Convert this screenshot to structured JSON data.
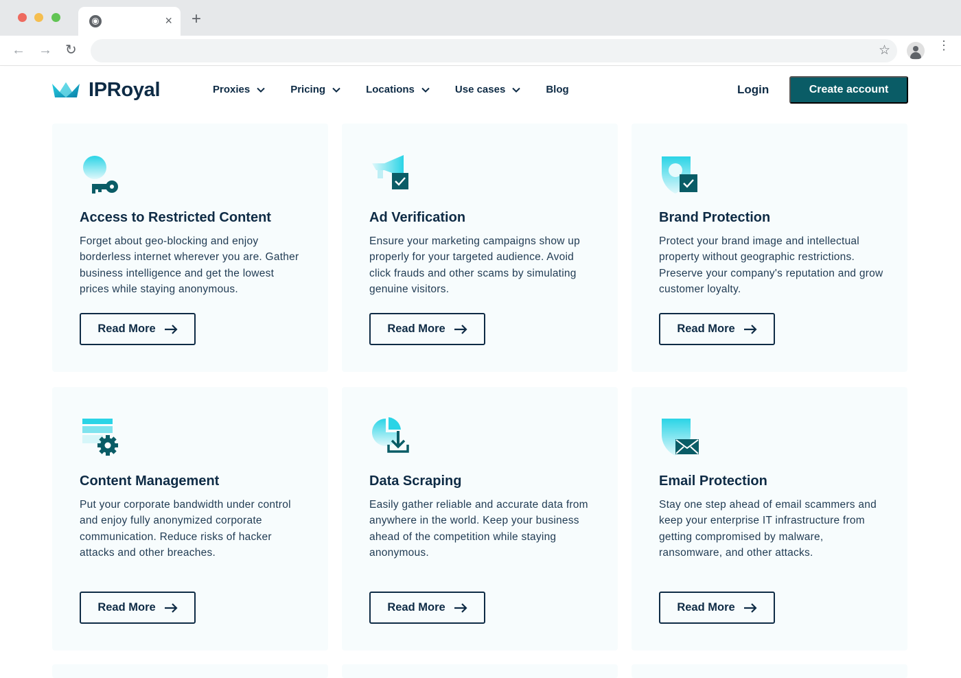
{
  "browser": {
    "tab_close": "×",
    "new_tab": "+",
    "back": "←",
    "forward": "→",
    "reload": "↻",
    "star": "☆",
    "menu": "⋮"
  },
  "header": {
    "logo_text": "IPRoyal",
    "nav": [
      {
        "label": "Proxies",
        "has_dropdown": true
      },
      {
        "label": "Pricing",
        "has_dropdown": true
      },
      {
        "label": "Locations",
        "has_dropdown": true
      },
      {
        "label": "Use cases",
        "has_dropdown": true
      },
      {
        "label": "Blog",
        "has_dropdown": false
      }
    ],
    "login": "Login",
    "cta": "Create account"
  },
  "colors": {
    "brand_dark": "#0e2b45",
    "accent_teal": "#0a5c66",
    "icon_cyan": "#2ad4e6",
    "card_bg": "#f7fcfd"
  },
  "cards": [
    {
      "icon": "key-icon",
      "title": "Access to Restricted Content",
      "description": "Forget about geo-blocking and enjoy borderless internet wherever you are. Gather business intelligence and get the lowest prices while staying anonymous.",
      "button": "Read More"
    },
    {
      "icon": "megaphone-check-icon",
      "title": "Ad Verification",
      "description": "Ensure your marketing campaigns show up properly for your targeted audience. Avoid click frauds and other scams by simulating genuine visitors.",
      "button": "Read More"
    },
    {
      "icon": "shield-check-icon",
      "title": "Brand Protection",
      "description": "Protect your brand image and intellectual property without geographic restrictions. Preserve your company's reputation and grow customer loyalty.",
      "button": "Read More"
    },
    {
      "icon": "settings-gear-icon",
      "title": "Content Management",
      "description": "Put your corporate bandwidth under control and enjoy fully anonymized corporate communication. Reduce risks of hacker attacks and other breaches.",
      "button": "Read More"
    },
    {
      "icon": "data-download-icon",
      "title": "Data Scraping",
      "description": "Easily gather reliable and accurate data from anywhere in the world. Keep your business ahead of the competition while staying anonymous.",
      "button": "Read More"
    },
    {
      "icon": "email-shield-icon",
      "title": "Email Protection",
      "description": "Stay one step ahead of email scammers and keep your enterprise IT infrastructure from getting compromised by malware, ransomware, and other attacks.",
      "button": "Read More"
    }
  ]
}
